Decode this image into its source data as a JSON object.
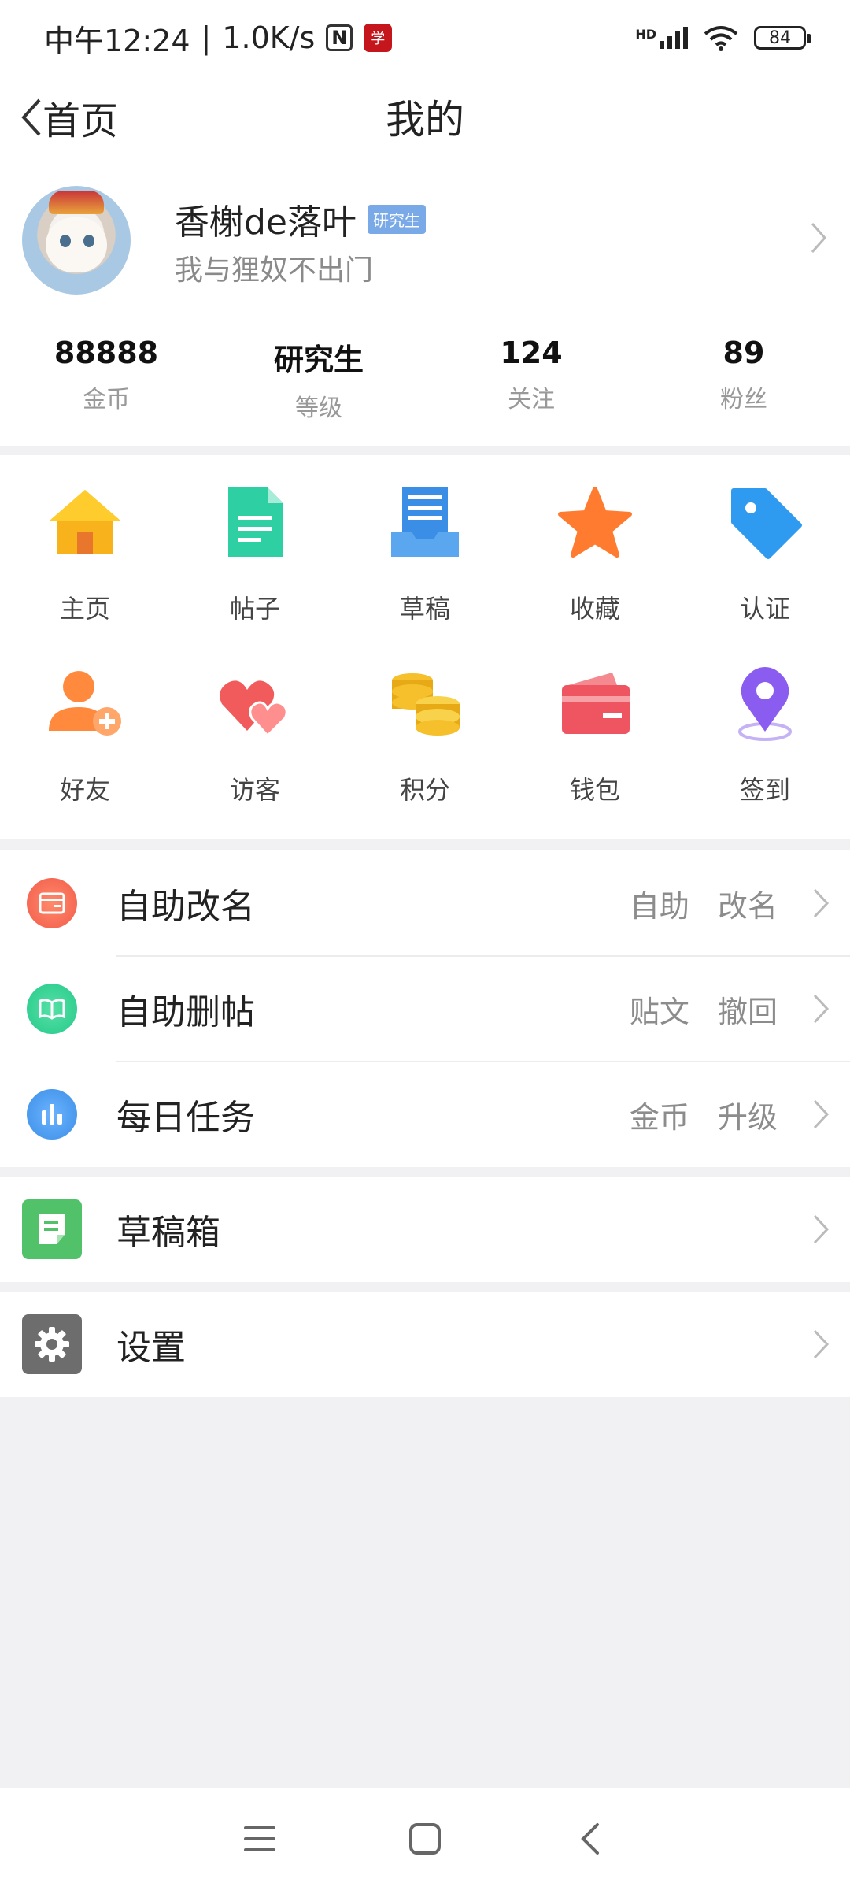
{
  "status_bar": {
    "time": "中午12:24",
    "speed": "1.0K/s",
    "nfc_label": "N",
    "app_badge": "学",
    "network": "HD",
    "battery": "84"
  },
  "nav": {
    "back_label": "首页",
    "title": "我的"
  },
  "profile": {
    "username": "香榭de落叶",
    "level_badge": "研究生",
    "signature": "我与狸奴不出门"
  },
  "stats": [
    {
      "value": "88888",
      "label": "金币"
    },
    {
      "value": "研究生",
      "label": "等级"
    },
    {
      "value": "124",
      "label": "关注"
    },
    {
      "value": "89",
      "label": "粉丝"
    }
  ],
  "grid": {
    "row1": [
      {
        "label": "主页",
        "icon": "home-icon",
        "color": "#f8b21b"
      },
      {
        "label": "帖子",
        "icon": "post-icon",
        "color": "#2fcfa4"
      },
      {
        "label": "草稿",
        "icon": "draft-icon",
        "color": "#3a8ee6"
      },
      {
        "label": "收藏",
        "icon": "star-icon",
        "color": "#ff7b2f"
      },
      {
        "label": "认证",
        "icon": "tag-icon",
        "color": "#2e9bf0"
      }
    ],
    "row2": [
      {
        "label": "好友",
        "icon": "add-friend-icon",
        "color": "#ff8a3d"
      },
      {
        "label": "访客",
        "icon": "hearts-icon",
        "color": "#f25b5b"
      },
      {
        "label": "积分",
        "icon": "coins-icon",
        "color": "#f5c02c"
      },
      {
        "label": "钱包",
        "icon": "wallet-icon",
        "color": "#ef5560"
      },
      {
        "label": "签到",
        "icon": "location-pin-icon",
        "color": "#8a5cf0"
      }
    ]
  },
  "menu": {
    "rename": {
      "label": "自助改名",
      "hint": "自助 改名"
    },
    "delete_post": {
      "label": "自助删帖",
      "hint": "贴文 撤回"
    },
    "daily_tasks": {
      "label": "每日任务",
      "hint": "金币 升级"
    },
    "drafts": {
      "label": "草稿箱"
    },
    "settings": {
      "label": "设置"
    }
  }
}
